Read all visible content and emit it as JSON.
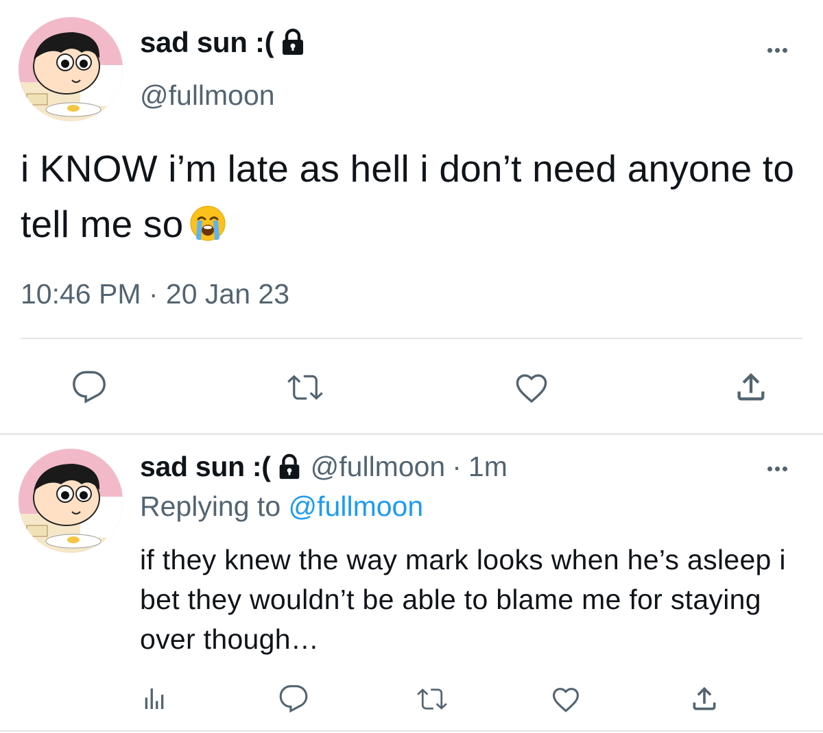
{
  "main_tweet": {
    "display_name": "sad sun :(",
    "handle": "@fullmoon",
    "text": "i KNOW i’m late as hell i don’t need anyone to tell me so",
    "emoji": "loudly-crying-face",
    "timestamp": "10:46 PM · 20 Jan 23",
    "actions": [
      "reply-icon",
      "retweet-icon",
      "like-icon",
      "share-icon"
    ]
  },
  "reply_tweet": {
    "display_name": "sad sun :(",
    "handle": "@fullmoon",
    "separator": "·",
    "time": "1m",
    "replying_prefix": "Replying to",
    "replying_to": "@fullmoon",
    "text": "if they knew the way mark looks when he’s asleep i bet they wouldn’t be able to blame me for staying over though…",
    "actions": [
      "analytics-icon",
      "reply-icon",
      "retweet-icon",
      "like-icon",
      "share-icon"
    ]
  },
  "colors": {
    "text": "#0f1419",
    "secondary": "#536471",
    "link": "#1d9bf0",
    "divider": "#e1e6ea"
  }
}
